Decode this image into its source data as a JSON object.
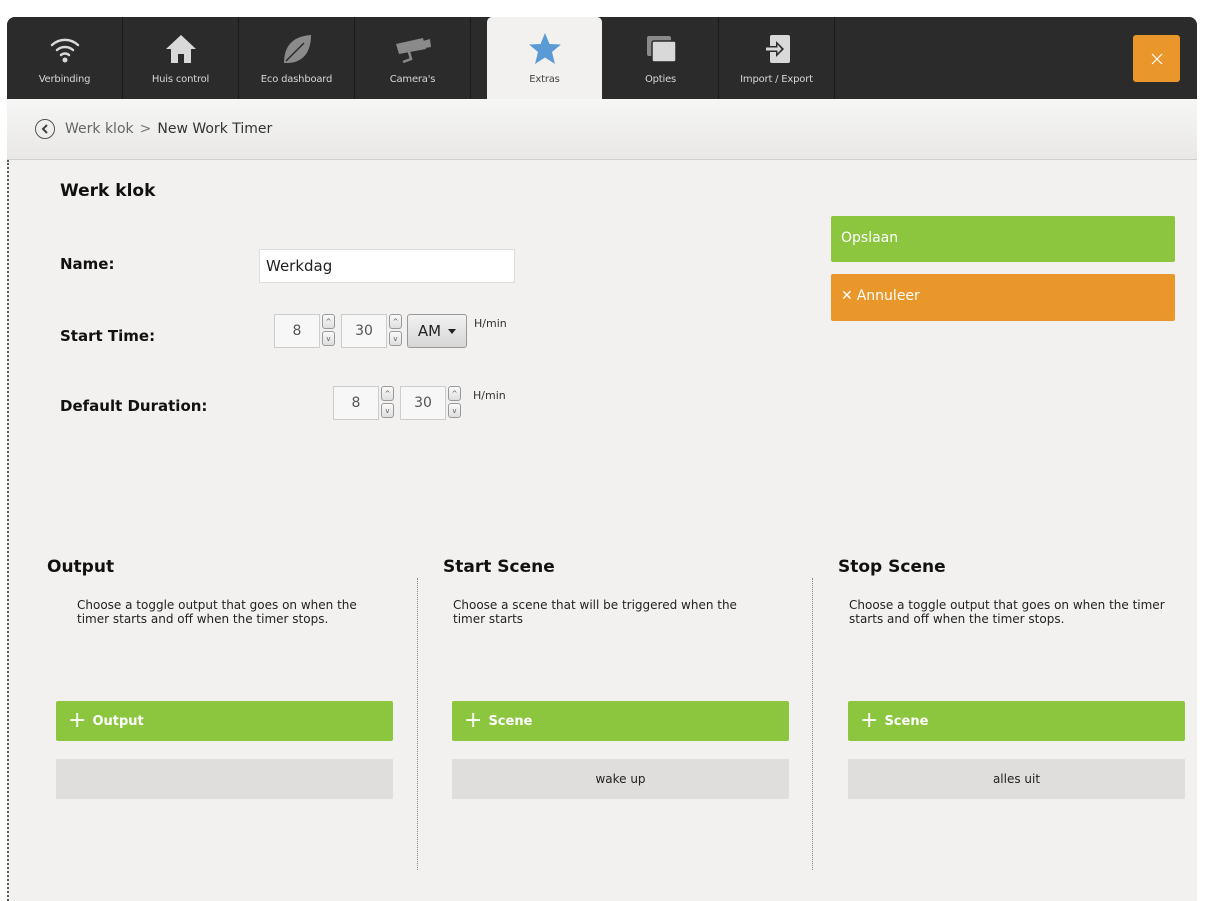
{
  "tabs": [
    {
      "label": "Verbinding",
      "icon": "wifi-icon"
    },
    {
      "label": "Huis control",
      "icon": "house-icon"
    },
    {
      "label": "Eco dashboard",
      "icon": "leaf-icon"
    },
    {
      "label": "Camera's",
      "icon": "camera-icon"
    },
    {
      "label": "Extras",
      "icon": "star-icon",
      "active": true
    },
    {
      "label": "Opties",
      "icon": "windows-icon"
    },
    {
      "label": "Import / Export",
      "icon": "import-export-icon"
    }
  ],
  "close_icon": "close-icon",
  "breadcrumb": {
    "parent": "Werk klok",
    "separator": ">",
    "current": "New Work Timer"
  },
  "form": {
    "title": "Werk klok",
    "name_label": "Name:",
    "name_value": "Werkdag",
    "start_time_label": "Start Time:",
    "start_hour": "8",
    "start_min": "30",
    "ampm": "AM",
    "unit": "H/min",
    "duration_label": "Default Duration:",
    "duration_hour": "8",
    "duration_min": "30"
  },
  "actions": {
    "save": "Opslaan",
    "cancel": "Annuleer"
  },
  "columns": {
    "output": {
      "title": "Output",
      "desc": "Choose a toggle output that goes on when the timer starts and off when the timer stops.",
      "add_label": "Output",
      "item": ""
    },
    "start_scene": {
      "title": "Start Scene",
      "desc": "Choose a scene that will be triggered when the timer starts",
      "add_label": "Scene",
      "item": "wake up"
    },
    "stop_scene": {
      "title": "Stop Scene",
      "desc": "Choose a toggle output that goes on when the timer starts and off when the timer stops.",
      "add_label": "Scene",
      "item": "alles uit"
    }
  },
  "colors": {
    "accent_green": "#8cc63f",
    "accent_orange": "#e9962a",
    "topbar": "#2b2b2b",
    "panel": "#f2f1ef"
  }
}
